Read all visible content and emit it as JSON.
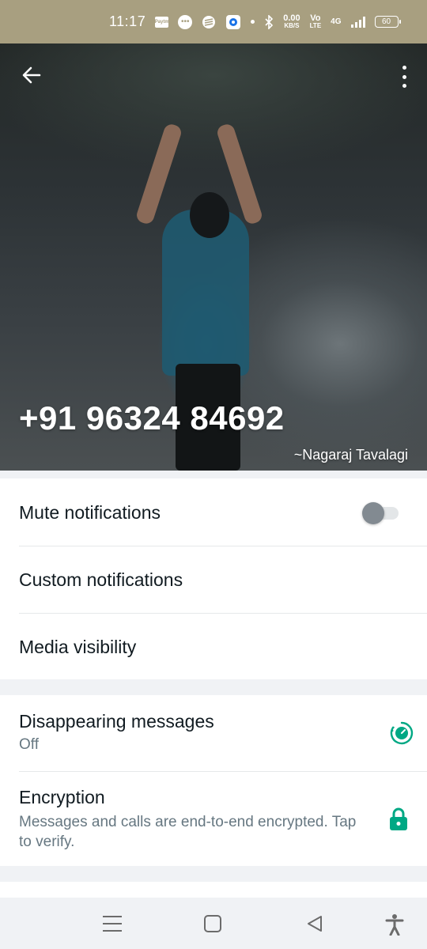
{
  "status_bar": {
    "time": "11:17",
    "icons": [
      "paytm-icon",
      "message-icon",
      "app-icon",
      "record-icon",
      "dot-icon",
      "bluetooth-icon",
      "data-speed-icon",
      "volte-icon",
      "4g-icon",
      "signal-icon",
      "battery-icon"
    ],
    "paytm_label": "Paytm",
    "data_speed_value": "0.00",
    "data_speed_unit": "KB/S",
    "volte_label_1": "Vo",
    "volte_label_2": "LTE",
    "network_label": "4G",
    "battery_level": "60"
  },
  "hero": {
    "phone": "+91 96324 84692",
    "name": "~Nagaraj Tavalagi",
    "back_icon": "arrow-back-icon",
    "menu_icon": "more-vert-icon"
  },
  "settings": {
    "mute": {
      "label": "Mute notifications",
      "enabled": false
    },
    "custom": {
      "label": "Custom notifications"
    },
    "media": {
      "label": "Media visibility"
    }
  },
  "privacy": {
    "disappearing": {
      "label": "Disappearing messages",
      "value": "Off",
      "icon": "timer-icon"
    },
    "encryption": {
      "label": "Encryption",
      "description": "Messages and calls are end-to-end encrypted. Tap to verify.",
      "icon": "lock-icon"
    }
  },
  "colors": {
    "accent": "#00a884",
    "status_bar": "#a89f80",
    "primary_text": "#111b21",
    "secondary_text": "#667781"
  },
  "nav_bar": {
    "buttons": [
      "menu-icon",
      "home-icon",
      "back-icon",
      "accessibility-icon"
    ]
  }
}
